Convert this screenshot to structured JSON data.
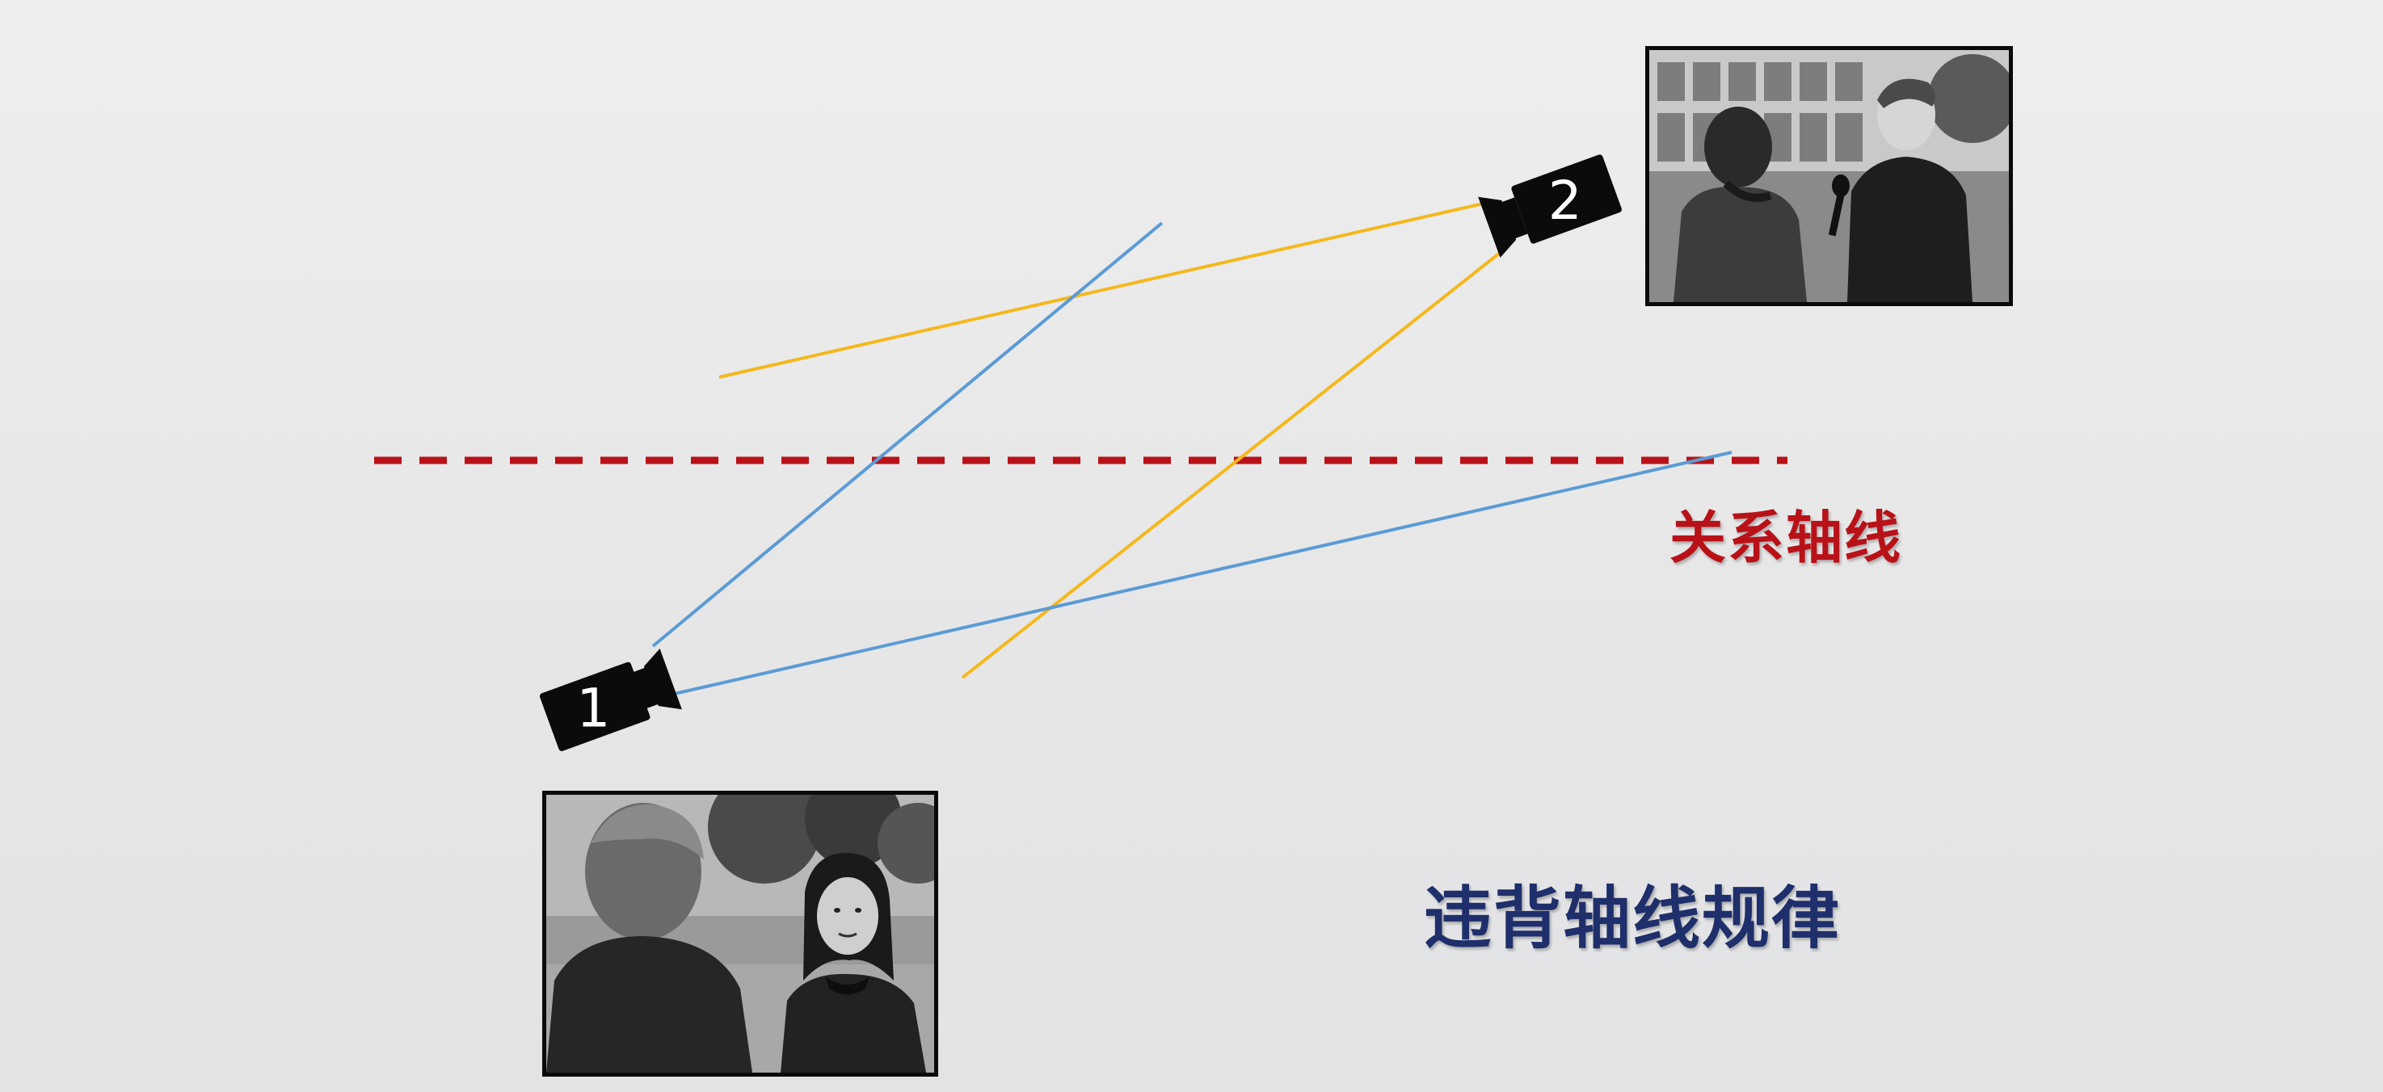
{
  "axis": {
    "label": "关系轴线",
    "color": "#b81218"
  },
  "title": {
    "text": "违背轴线规律",
    "color": "#1f2f6b"
  },
  "cameras": [
    {
      "label": "1",
      "icon": "film-camera-icon",
      "view_line_color": "#5b9bd5"
    },
    {
      "label": "2",
      "icon": "film-camera-icon",
      "view_line_color": "#f5b81c"
    }
  ],
  "colors": {
    "background": "#e8e8e9",
    "axis_line": "#b81218",
    "camera_1_view": "#5b9bd5",
    "camera_2_view": "#f5b81c",
    "camera_body": "#0b0b0b"
  },
  "photos": [
    {
      "name": "camera-2-shot",
      "description_icon": "bw-photo-interview-icon"
    },
    {
      "name": "camera-1-shot",
      "description_icon": "bw-photo-two-people-icon"
    }
  ]
}
